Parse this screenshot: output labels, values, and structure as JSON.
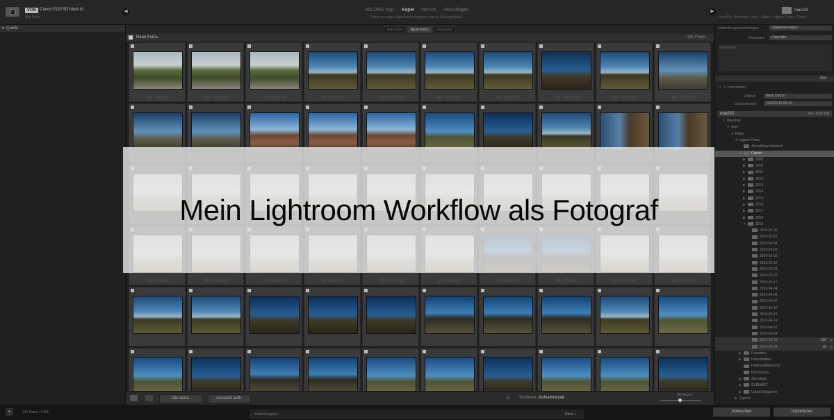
{
  "header": {
    "source_badge": "VON",
    "source_name": "Canon EOS 5D Mark III",
    "source_sub": "Alle Fotos",
    "modes": [
      "Als DNG kop.",
      "Kopie",
      "Versch.",
      "Hinzufügen"
    ],
    "active_mode": "Kopie",
    "mode_description": "Fotos an neuen Speicherort kopieren und zu Katalog hinzuf.",
    "dest_name": "macOS",
    "dest_path": "macOS › Benutzer › sven › Bilder › eigene Fotos › Canon"
  },
  "left_panel": {
    "header": "Quelle"
  },
  "grid": {
    "tabs": [
      "Alle Fotos",
      "Neue Fotos",
      "Zielordner"
    ],
    "active_tab": "Neue Fotos",
    "collection_name": "Neue Fotos",
    "collection_count": "141 Fotos",
    "rows": [
      [
        {
          "caption": "SDI_3328.CR2",
          "thumb": "path"
        },
        {
          "caption": "SDI_3329.CR2",
          "thumb": "path"
        },
        {
          "caption": "SDI_3330.CR2",
          "thumb": "path"
        },
        {
          "caption": "SDI_3331.CR2",
          "thumb": "lake"
        },
        {
          "caption": "SDI_3332.CR2",
          "thumb": "lake"
        },
        {
          "caption": "SDI_3333.CR2",
          "thumb": "lake"
        },
        {
          "caption": "SDI_3334.CR2",
          "thumb": "lake"
        },
        {
          "caption": "SDI_3335.CR2",
          "thumb": "dark"
        },
        {
          "caption": "SDI_3336.CR2",
          "thumb": "lake"
        },
        {
          "caption": "SDI_3337.CR2",
          "thumb": "bench"
        }
      ],
      [
        {
          "caption": "",
          "thumb": "bench"
        },
        {
          "caption": "",
          "thumb": "bench"
        },
        {
          "caption": "",
          "thumb": "hut"
        },
        {
          "caption": "",
          "thumb": "hut"
        },
        {
          "caption": "",
          "thumb": "hut"
        },
        {
          "caption": "",
          "thumb": "tree"
        },
        {
          "caption": "",
          "thumb": "dark"
        },
        {
          "caption": "",
          "thumb": "lake"
        },
        {
          "caption": "",
          "thumb": "vert"
        },
        {
          "caption": "",
          "thumb": "vert"
        }
      ],
      [
        {
          "caption": "",
          "thumb": "pale"
        },
        {
          "caption": "",
          "thumb": "pale"
        },
        {
          "caption": "",
          "thumb": "pale"
        },
        {
          "caption": "",
          "thumb": "pale"
        },
        {
          "caption": "",
          "thumb": "pale"
        },
        {
          "caption": "",
          "thumb": "pale"
        },
        {
          "caption": "",
          "thumb": "pale"
        },
        {
          "caption": "",
          "thumb": "pale"
        },
        {
          "caption": "",
          "thumb": "pale"
        },
        {
          "caption": "",
          "thumb": "pale"
        }
      ],
      [
        {
          "caption": "SDI_3363.CR2",
          "thumb": "pale"
        },
        {
          "caption": "SDI_3364.CR2",
          "thumb": "pale"
        },
        {
          "caption": "SDI_3365.CR2",
          "thumb": "pale"
        },
        {
          "caption": "SDI_3366.CR2",
          "thumb": "pale"
        },
        {
          "caption": "SDI_3367.CR2",
          "thumb": "pale"
        },
        {
          "caption": "SDI_3368.CR2",
          "thumb": "pale"
        },
        {
          "caption": "SDI_3369.CR2",
          "thumb": "fence"
        },
        {
          "caption": "SDI_3370.CR2",
          "thumb": "fence"
        },
        {
          "caption": "SDI_3371.CR2",
          "thumb": "pale"
        },
        {
          "caption": "SDI_3372.CR2",
          "thumb": "pale"
        }
      ],
      [
        {
          "caption": "",
          "thumb": "lake"
        },
        {
          "caption": "",
          "thumb": "lake"
        },
        {
          "caption": "",
          "thumb": "dark"
        },
        {
          "caption": "",
          "thumb": "dark"
        },
        {
          "caption": "",
          "thumb": "dark"
        },
        {
          "caption": "",
          "thumb": "fence"
        },
        {
          "caption": "",
          "thumb": "fence"
        },
        {
          "caption": "",
          "thumb": "fence"
        },
        {
          "caption": "",
          "thumb": "lake"
        },
        {
          "caption": "",
          "thumb": "tree"
        }
      ],
      [
        {
          "caption": "",
          "thumb": "tree"
        },
        {
          "caption": "",
          "thumb": "dark"
        },
        {
          "caption": "",
          "thumb": "fence"
        },
        {
          "caption": "",
          "thumb": "fence"
        },
        {
          "caption": "",
          "thumb": "tree"
        },
        {
          "caption": "",
          "thumb": "tree"
        },
        {
          "caption": "",
          "thumb": "dark"
        },
        {
          "caption": "",
          "thumb": "tree"
        },
        {
          "caption": "",
          "thumb": "tree"
        },
        {
          "caption": "",
          "thumb": "dark"
        }
      ]
    ]
  },
  "toolbar": {
    "check_all": "Alle mark.",
    "uncheck_all": "Auswahl aufh.",
    "sort_label": "Sortieren:",
    "sort_value": "Aufnahmezeit",
    "thumb_label": "Miniaturen"
  },
  "right_panel": {
    "rows": [
      {
        "label": "Entwicklungseinstellungen",
        "value": "Objektivkorrektur"
      },
      {
        "label": "Metadaten",
        "value": "Copyright"
      }
    ],
    "keywords_label": "Stichwörter",
    "ziel_header": "Ziel",
    "subfolder_label": "In Unterordner",
    "organize_label": "Ordnen",
    "organize_value": "Nach Datum",
    "dateformat_label": "Datumsformat",
    "dateformat_value": "2019/2019-05-24",
    "volume_name": "macOS",
    "volume_free": "3/4 / 1000 GB",
    "folders": [
      {
        "label": "Benutzer",
        "level": 0,
        "tri": "▼"
      },
      {
        "label": "sven",
        "level": 1,
        "tri": "▼"
      },
      {
        "label": "Bilder",
        "level": 2,
        "tri": "▼"
      },
      {
        "label": "eigene Fotos",
        "level": 3,
        "tri": "▼"
      },
      {
        "label": "Alexa&Kay Hochzeit",
        "level": 4,
        "tri": ""
      },
      {
        "label": "Canon",
        "level": 4,
        "tri": "▼",
        "selected": true
      },
      {
        "label": "2009",
        "level": 5,
        "tri": "▶"
      },
      {
        "label": "2010",
        "level": 5,
        "tri": "▶"
      },
      {
        "label": "2011",
        "level": 5,
        "tri": "▶"
      },
      {
        "label": "2012",
        "level": 5,
        "tri": "▶"
      },
      {
        "label": "2013",
        "level": 5,
        "tri": "▶"
      },
      {
        "label": "2014",
        "level": 5,
        "tri": "▶"
      },
      {
        "label": "2015",
        "level": 5,
        "tri": "▶"
      },
      {
        "label": "2016",
        "level": 5,
        "tri": "▶"
      },
      {
        "label": "2017",
        "level": 5,
        "tri": "▶"
      },
      {
        "label": "2018",
        "level": 5,
        "tri": "▶"
      },
      {
        "label": "2019",
        "level": 5,
        "tri": "▼"
      },
      {
        "label": "2019-01-06",
        "level": 6,
        "tri": ""
      },
      {
        "label": "2019-01-27",
        "level": 6,
        "tri": ""
      },
      {
        "label": "2019-02-04",
        "level": 6,
        "tri": ""
      },
      {
        "label": "2019-02-09",
        "level": 6,
        "tri": ""
      },
      {
        "label": "2019-02-10",
        "level": 6,
        "tri": ""
      },
      {
        "label": "2019-02-19",
        "level": 6,
        "tri": ""
      },
      {
        "label": "2019-02-24",
        "level": 6,
        "tri": ""
      },
      {
        "label": "2019-02-27",
        "level": 6,
        "tri": ""
      },
      {
        "label": "2019-03-17",
        "level": 6,
        "tri": ""
      },
      {
        "label": "2019-04-04",
        "level": 6,
        "tri": ""
      },
      {
        "label": "2019-04-06",
        "level": 6,
        "tri": ""
      },
      {
        "label": "2019-04-07",
        "level": 6,
        "tri": ""
      },
      {
        "label": "2019-04-10",
        "level": 6,
        "tri": ""
      },
      {
        "label": "2019-04-13",
        "level": 6,
        "tri": ""
      },
      {
        "label": "2019-04-19",
        "level": 6,
        "tri": ""
      },
      {
        "label": "2019-04-22",
        "level": 6,
        "tri": ""
      },
      {
        "label": "2019-05-04",
        "level": 6,
        "tri": ""
      },
      {
        "label": "2019-05-19",
        "level": 6,
        "tri": "",
        "count": "126",
        "check": "✓",
        "hl": true
      },
      {
        "label": "2019-05-24",
        "level": 6,
        "tri": "",
        "count": "15",
        "check": "✓",
        "hl": true
      },
      {
        "label": "Favoriten",
        "level": 4,
        "tri": "▶"
      },
      {
        "label": "Fotoarbeiten",
        "level": 4,
        "tri": "▶"
      },
      {
        "label": "HallenradWM2012",
        "level": 4,
        "tri": ""
      },
      {
        "label": "Panoramas",
        "level": 4,
        "tri": ""
      },
      {
        "label": "Shootings",
        "level": 4,
        "tri": "▶"
      },
      {
        "label": "SVENART",
        "level": 4,
        "tri": "▶"
      },
      {
        "label": "Urlaub Bulgarien",
        "level": 4,
        "tri": "▶"
      },
      {
        "label": "Eigene",
        "level": 3,
        "tri": "▶"
      }
    ]
  },
  "status_bar": {
    "info": "141 Fotos / 4 GB",
    "preset_label": "Importvorgabe",
    "preset_value": "Ohne ÷",
    "cancel": "Abbrechen",
    "import": "Importieren"
  },
  "overlay": {
    "title": "Mein Lightroom Workflow als Fotograf"
  }
}
